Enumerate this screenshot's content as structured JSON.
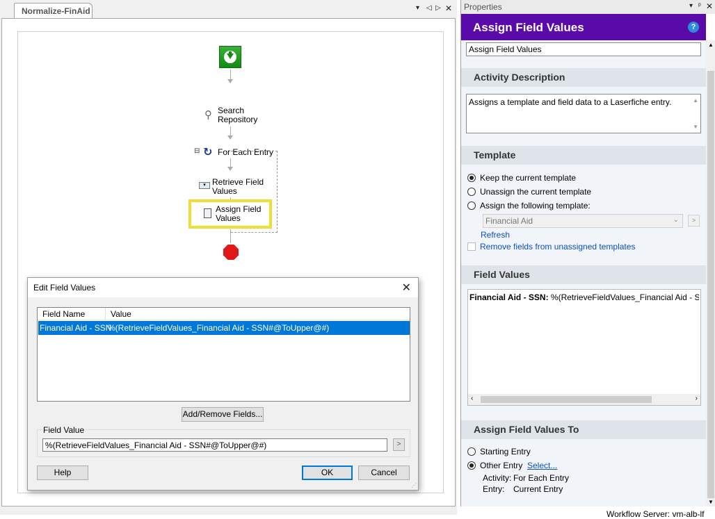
{
  "document_tab": {
    "title": "Normalize-FinAid",
    "controls": [
      "▾",
      "◁",
      "▷",
      "✕"
    ]
  },
  "workflow": {
    "nodes": {
      "search_repository": "Search Repository",
      "for_each_entry": "For Each Entry",
      "retrieve_field_values": "Retrieve Field Values",
      "assign_field_values": "Assign Field Values"
    },
    "collapse_glyph": "⊟"
  },
  "dialog": {
    "title": "Edit Field Values",
    "close_glyph": "✕",
    "table": {
      "columns": [
        "Field Name",
        "Value"
      ],
      "rows": [
        {
          "field_name": "Financial Aid - SSN",
          "value": "%(RetrieveFieldValues_Financial Aid - SSN#@ToUpper@#)"
        }
      ]
    },
    "add_remove_label": "Add/Remove Fields...",
    "field_value_label": "Field Value",
    "field_value": "%(RetrieveFieldValues_Financial Aid - SSN#@ToUpper@#)",
    "browse_glyph": ">",
    "help_label": "Help",
    "ok_label": "OK",
    "cancel_label": "Cancel"
  },
  "properties": {
    "pane_title": "Properties",
    "pane_controls": [
      "▾",
      "ᵖ",
      "✕"
    ],
    "header": "Assign Field Values",
    "help_glyph": "?",
    "name_value": "Assign Field Values",
    "activity_description": {
      "heading": "Activity Description",
      "text": "Assigns a template and field data to a Laserfiche entry."
    },
    "template": {
      "heading": "Template",
      "options": [
        "Keep the current template",
        "Unassign the current template",
        "Assign the following template:"
      ],
      "selected_index": 0,
      "template_select": "Financial Aid",
      "refresh_label": "Refresh",
      "remove_fields_label": "Remove fields from unassigned templates",
      "remove_fields_checked": false
    },
    "field_values": {
      "heading": "Field Values",
      "entry_name": "Financial Aid - SSN:",
      "entry_value": " %(RetrieveFieldValues_Financial Aid - SSN#@"
    },
    "assign_to": {
      "heading": "Assign Field Values To",
      "options": [
        "Starting Entry",
        "Other Entry"
      ],
      "selected_index": 1,
      "select_link": "Select...",
      "activity_label": "Activity:",
      "activity_value": "For Each Entry",
      "entry_label": "Entry:",
      "entry_value": "Current Entry"
    }
  },
  "status_bar": {
    "text": "Workflow Server: vm-alb-lf"
  },
  "colors": {
    "header_purple": "#5a0aa8",
    "selection_blue": "#0078d7",
    "link_blue": "#0a50c8",
    "start_green": "#138a13",
    "stop_red": "#e01818",
    "highlight_yellow": "#f0e030"
  }
}
